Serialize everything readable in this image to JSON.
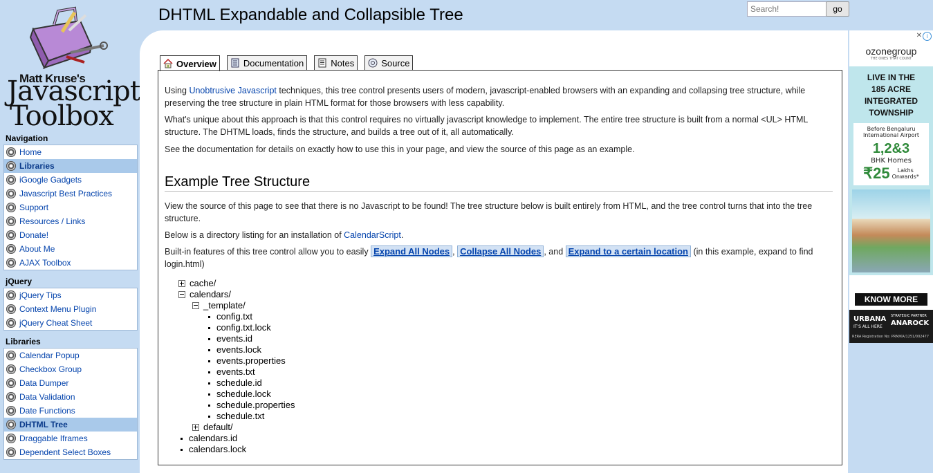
{
  "site": {
    "brand_line1": "Matt Kruse's",
    "brand_line2": "Javascript",
    "brand_line3": "Toolbox"
  },
  "header": {
    "title": "DHTML Expandable and Collapsible Tree",
    "search_placeholder": "Search!",
    "search_button": "go"
  },
  "sidebar": {
    "sections": [
      {
        "heading": "Navigation",
        "items": [
          {
            "label": "Home",
            "active": false
          },
          {
            "label": "Libraries",
            "active": true
          },
          {
            "label": "iGoogle Gadgets",
            "active": false
          },
          {
            "label": "Javascript Best Practices",
            "active": false
          },
          {
            "label": "Support",
            "active": false
          },
          {
            "label": "Resources / Links",
            "active": false
          },
          {
            "label": "Donate!",
            "active": false
          },
          {
            "label": "About Me",
            "active": false
          },
          {
            "label": "AJAX Toolbox",
            "active": false
          }
        ]
      },
      {
        "heading": "jQuery",
        "items": [
          {
            "label": "jQuery Tips",
            "active": false
          },
          {
            "label": "Context Menu Plugin",
            "active": false
          },
          {
            "label": "jQuery Cheat Sheet",
            "active": false
          }
        ]
      },
      {
        "heading": "Libraries",
        "items": [
          {
            "label": "Calendar Popup",
            "active": false
          },
          {
            "label": "Checkbox Group",
            "active": false
          },
          {
            "label": "Data Dumper",
            "active": false
          },
          {
            "label": "Data Validation",
            "active": false
          },
          {
            "label": "Date Functions",
            "active": false
          },
          {
            "label": "DHTML Tree",
            "active": true
          },
          {
            "label": "Draggable Iframes",
            "active": false
          },
          {
            "label": "Dependent Select Boxes",
            "active": false
          }
        ]
      }
    ]
  },
  "tabs": [
    {
      "label": "Overview",
      "icon": "home-icon",
      "active": true
    },
    {
      "label": "Documentation",
      "icon": "document-icon",
      "active": false
    },
    {
      "label": "Notes",
      "icon": "notes-icon",
      "active": false
    },
    {
      "label": "Source",
      "icon": "source-icon",
      "active": false
    }
  ],
  "content": {
    "p1_before": "Using ",
    "p1_link": "Unobtrusive Javascript",
    "p1_after": " techniques, this tree control presents users of modern, javascript-enabled browsers with an expanding and collapsing tree structure, while preserving the tree structure in plain HTML format for those browsers with less capability.",
    "p2": "What's unique about this approach is that this control requires no virtually javascript knowledge to implement. The entire tree structure is built from a normal <UL> HTML structure. The DHTML loads, finds the structure, and builds a tree out of it, all automatically.",
    "p3": "See the documentation for details on exactly how to use this in your page, and view the source of this page as an example.",
    "section_heading": "Example Tree Structure",
    "p4": "View the source of this page to see that there is no Javascript to be found! The tree structure below is built entirely from HTML, and the tree control turns that into the tree structure.",
    "p5_before": "Below is a directory listing for an installation of ",
    "p5_link": "CalendarScript",
    "p5_after": ".",
    "p6_before": "Built-in features of this tree control allow you to easily ",
    "expand_all": "Expand All Nodes",
    "p6_sep1": ", ",
    "collapse_all": "Collapse All Nodes",
    "p6_sep2": ", and ",
    "expand_to": "Expand to a certain location",
    "p6_after": " (in this example, expand to find login.html)"
  },
  "tree": [
    {
      "label": "cache/",
      "level": 0,
      "kind": "collapsed"
    },
    {
      "label": "calendars/",
      "level": 0,
      "kind": "expanded"
    },
    {
      "label": "_template/",
      "level": 1,
      "kind": "expanded"
    },
    {
      "label": "config.txt",
      "level": 2,
      "kind": "leaf"
    },
    {
      "label": "config.txt.lock",
      "level": 2,
      "kind": "leaf"
    },
    {
      "label": "events.id",
      "level": 2,
      "kind": "leaf"
    },
    {
      "label": "events.lock",
      "level": 2,
      "kind": "leaf"
    },
    {
      "label": "events.properties",
      "level": 2,
      "kind": "leaf"
    },
    {
      "label": "events.txt",
      "level": 2,
      "kind": "leaf"
    },
    {
      "label": "schedule.id",
      "level": 2,
      "kind": "leaf"
    },
    {
      "label": "schedule.lock",
      "level": 2,
      "kind": "leaf"
    },
    {
      "label": "schedule.properties",
      "level": 2,
      "kind": "leaf"
    },
    {
      "label": "schedule.txt",
      "level": 2,
      "kind": "leaf"
    },
    {
      "label": "default/",
      "level": 1,
      "kind": "collapsed"
    },
    {
      "label": "calendars.id",
      "level": 0,
      "kind": "leaf"
    },
    {
      "label": "calendars.lock",
      "level": 0,
      "kind": "leaf"
    }
  ],
  "ad": {
    "brand": "ozonegroup",
    "tagline": "THE ONES THAT COUNT",
    "headline_1": "LIVE IN THE",
    "headline_2": "185 ACRE",
    "headline_3": "INTEGRATED",
    "headline_4": "TOWNSHIP",
    "location_1": "Before Bengaluru",
    "location_2": "International Airport",
    "bhk": "1,2&3",
    "homes": "BHK Homes",
    "price": "₹25",
    "price_unit_1": "Lakhs",
    "price_unit_2": "Onwards*",
    "cta": "KNOW MORE",
    "footer_brand": "URBANA",
    "footer_brand_sub": "IT'S ALL HERE",
    "footer_partner_label": "STRATEGIC PARTNER",
    "footer_partner": "ANAROCK",
    "footer_rera": "RERA Registration No: PRM/KA/1251/002477",
    "close_symbol": "✕",
    "info_symbol": "i"
  }
}
